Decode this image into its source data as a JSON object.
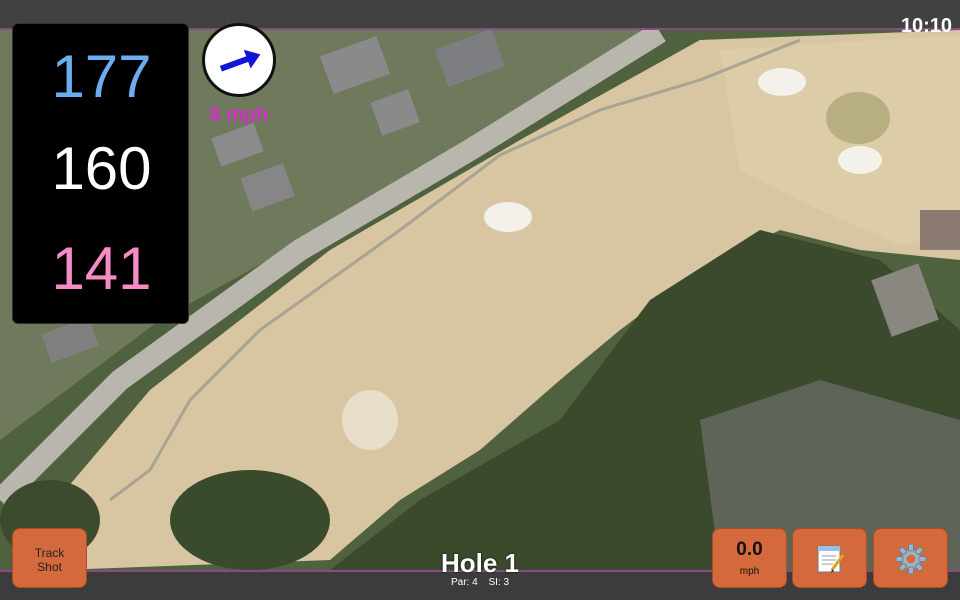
{
  "status": {
    "clock": "10:10"
  },
  "distances": {
    "back": "177",
    "center": "160",
    "front": "141"
  },
  "wind": {
    "speed_label": "8 mph",
    "icon": "wind-direction-arrow-icon"
  },
  "hole": {
    "title": "Hole 1",
    "par": "Par: 4",
    "stroke_index": "SI: 3"
  },
  "buttons": {
    "track_shot": {
      "line1": "Track",
      "line2": "Shot"
    },
    "speed": {
      "value": "0.0",
      "unit": "mph"
    },
    "notes": {
      "icon": "notepad-icon"
    },
    "settings": {
      "icon": "gear-icon"
    }
  },
  "colors": {
    "back_distance": "#6aaeef",
    "center_distance": "#ffffff",
    "front_distance": "#f48cc6",
    "wind_label": "#d02fc8",
    "button_orange": "#d46a3c"
  }
}
